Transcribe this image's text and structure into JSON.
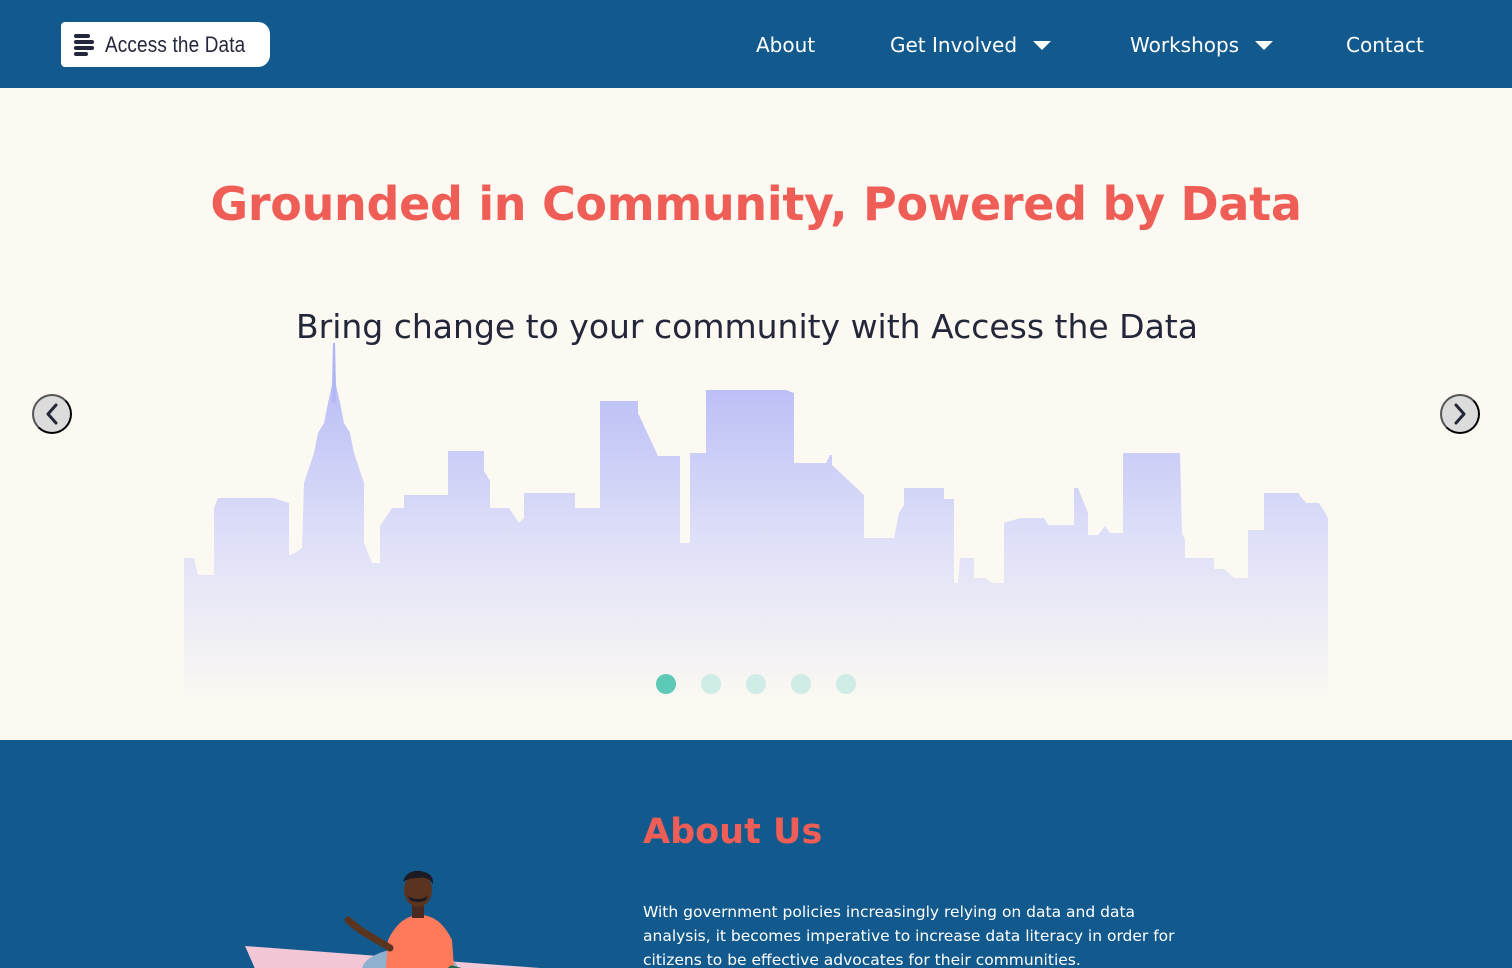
{
  "nav": {
    "logo_text": "Access the Data",
    "items": [
      {
        "label": "About",
        "dropdown": false
      },
      {
        "label": "Get Involved",
        "dropdown": true
      },
      {
        "label": "Workshops",
        "dropdown": true
      },
      {
        "label": "Contact",
        "dropdown": false
      }
    ]
  },
  "hero": {
    "title": "Grounded in Community, Powered by Data",
    "subtitle": "Bring change to your community with Access the Data",
    "carousel": {
      "slide_count": 5,
      "active_index": 0
    }
  },
  "about": {
    "title": "About Us",
    "text": "With government policies increasingly relying on data and data analysis, it becomes imperative to increase data literacy in order for citizens to be effective advocates for their communities."
  },
  "colors": {
    "nav_bg": "#125a8e",
    "accent": "#ef5e56",
    "hero_bg": "#fcf9f2",
    "dot_active": "#5ccab6",
    "dot_inactive": "#cfece6",
    "skyline": "#b4b9f5"
  },
  "icons": {
    "logo": "stacked-lines-icon",
    "prev": "chevron-left-icon",
    "next": "chevron-right-icon",
    "dropdown": "caret-down-icon"
  }
}
